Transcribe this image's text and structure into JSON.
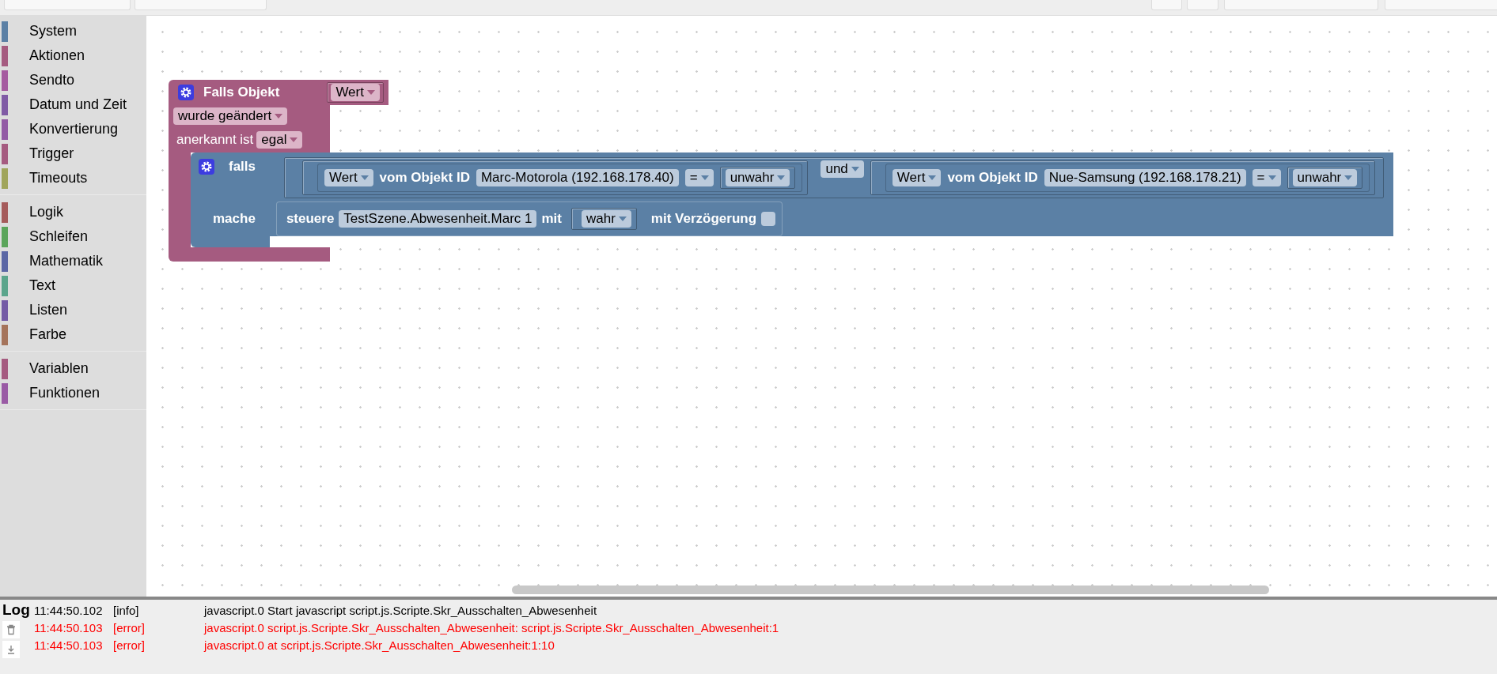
{
  "sidebar": {
    "groups": [
      {
        "items": [
          {
            "label": "System",
            "color": "#5b80a5"
          },
          {
            "label": "Aktionen",
            "color": "#a55b80"
          },
          {
            "label": "Sendto",
            "color": "#a55ba0"
          },
          {
            "label": "Datum und Zeit",
            "color": "#805ba5"
          },
          {
            "label": "Konvertierung",
            "color": "#935ba5"
          },
          {
            "label": "Trigger",
            "color": "#a55b80"
          },
          {
            "label": "Timeouts",
            "color": "#a0a55b"
          }
        ]
      },
      {
        "items": [
          {
            "label": "Logik",
            "color": "#a55b5b"
          },
          {
            "label": "Schleifen",
            "color": "#5ba55b"
          },
          {
            "label": "Mathematik",
            "color": "#5b67a5"
          },
          {
            "label": "Text",
            "color": "#5ba58c"
          },
          {
            "label": "Listen",
            "color": "#745ba5"
          },
          {
            "label": "Farbe",
            "color": "#a5745b"
          }
        ]
      },
      {
        "items": [
          {
            "label": "Variablen",
            "color": "#a55b80"
          },
          {
            "label": "Funktionen",
            "color": "#9a5ba5"
          }
        ]
      }
    ]
  },
  "canvas": {
    "trigger_block": {
      "title": "Falls Objekt",
      "object_value": "Wert",
      "event": "wurde geändert",
      "ack_label": "anerkannt ist",
      "ack_value": "egal",
      "if_block": {
        "if_label": "falls",
        "do_label": "mache",
        "condition": {
          "operator": "und",
          "comparisons": [
            {
              "value": "Wert",
              "label": "vom Objekt ID",
              "object": "Marc-Motorola (192.168.178.40)",
              "operator": "=",
              "compare": "unwahr"
            },
            {
              "value": "Wert",
              "label": "vom Objekt ID",
              "object": "Nue-Samsung (192.168.178.21)",
              "operator": "=",
              "compare": "unwahr"
            }
          ]
        },
        "action": {
          "label": "steuere",
          "object": "TestSzene.Abwesenheit.Marc 1",
          "with_label": "mit",
          "value": "wahr",
          "delay_label": "mit Verzögerung",
          "delay": false
        }
      }
    }
  },
  "log": {
    "title": "Log",
    "entries": [
      {
        "time": "11:44:50.102",
        "level": "[info]",
        "kind": "info",
        "message": "javascript.0 Start javascript script.js.Scripte.Skr_Ausschalten_Abwesenheit"
      },
      {
        "time": "11:44:50.103",
        "level": "[error]",
        "kind": "error",
        "message": "javascript.0 script.js.Scripte.Skr_Ausschalten_Abwesenheit: script.js.Scripte.Skr_Ausschalten_Abwesenheit:1"
      },
      {
        "time": "11:44:50.103",
        "level": "[error]",
        "kind": "error",
        "message": "javascript.0 at script.js.Scripte.Skr_Ausschalten_Abwesenheit:1:10"
      }
    ]
  }
}
